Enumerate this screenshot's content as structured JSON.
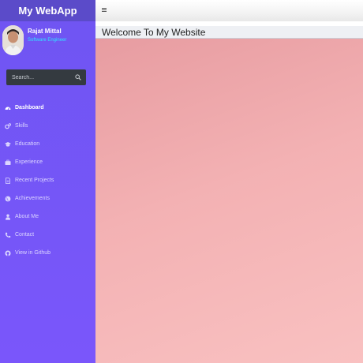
{
  "app": {
    "title": "My WebApp"
  },
  "profile": {
    "name": "Rajat Mittal",
    "role": "Software Engineer"
  },
  "search": {
    "placeholder": "Search..."
  },
  "sidebar": {
    "items": [
      {
        "label": "Dashboard",
        "icon": "dashboard-icon",
        "active": true
      },
      {
        "label": "Skills",
        "icon": "cogs-icon"
      },
      {
        "label": "Education",
        "icon": "graduation-cap-icon"
      },
      {
        "label": "Experience",
        "icon": "briefcase-icon"
      },
      {
        "label": "Recent Projects",
        "icon": "document-icon"
      },
      {
        "label": "Achievements",
        "icon": "globe-icon"
      },
      {
        "label": "About Me",
        "icon": "user-icon"
      },
      {
        "label": "Contact",
        "icon": "phone-icon"
      },
      {
        "label": "View in Github",
        "icon": "github-icon"
      }
    ]
  },
  "header": {
    "menu_icon": "hamburger-icon"
  },
  "main": {
    "title": "Welcome To My Website"
  },
  "colors": {
    "sidebar": "#7556f7",
    "brand": "#5b4bc9",
    "role": "#2ee6ff",
    "hero": "#f3b1b3"
  }
}
